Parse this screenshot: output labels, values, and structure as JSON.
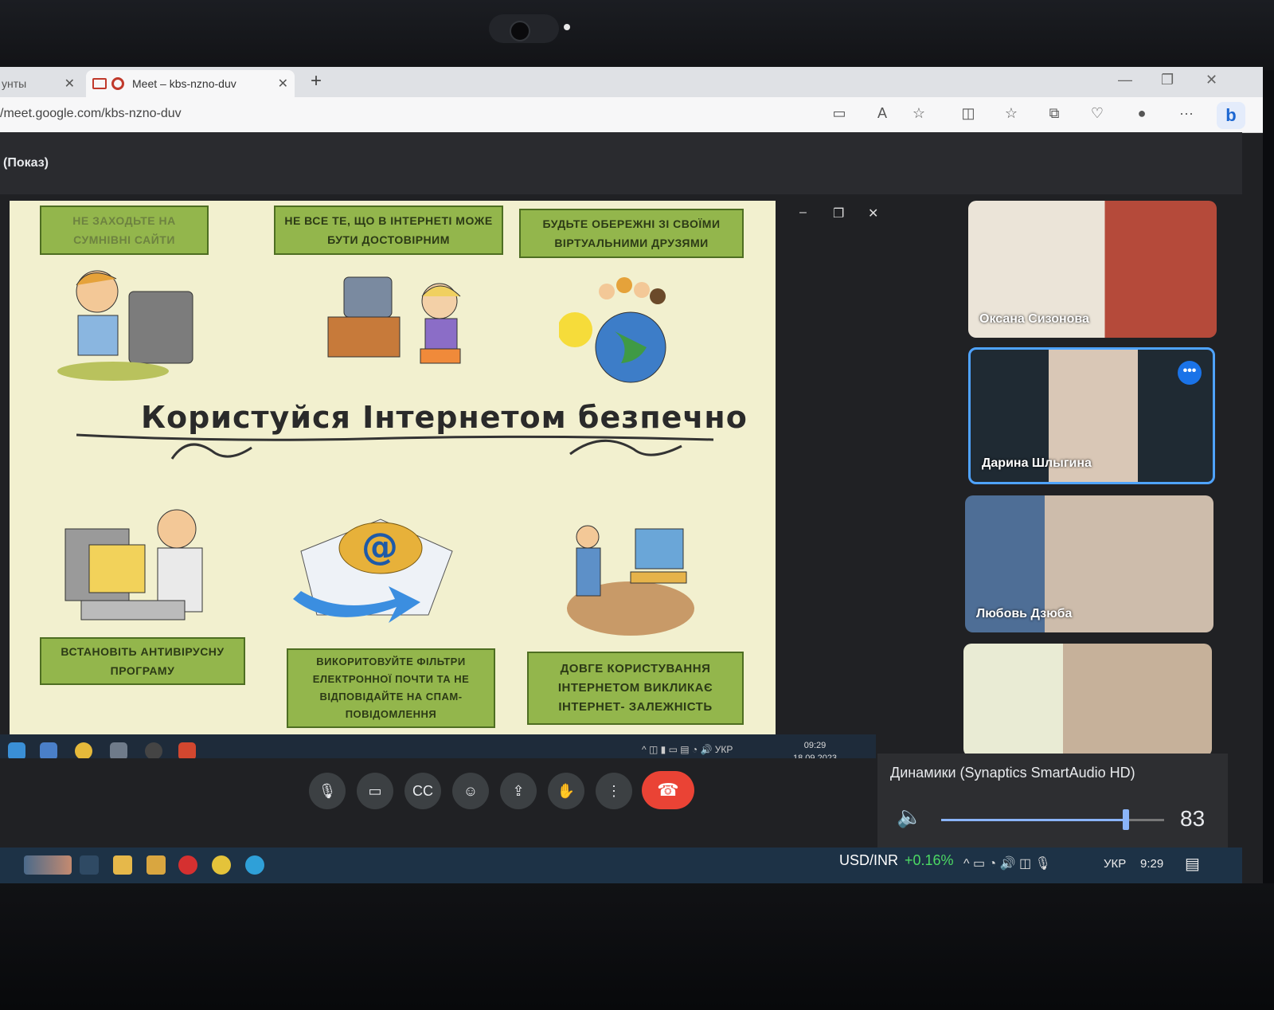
{
  "browser": {
    "inactive_tab_label": "унты",
    "active_tab_label": "Meet – kbs-nzno-duv",
    "url": "/meet.google.com/kbs-nzno-duv"
  },
  "meet": {
    "presentation_title": "(Показ)"
  },
  "slide": {
    "title": "Користуйся Інтернетом безпечно",
    "captions": [
      "НЕ ЗАХОДЬТЕ НА СУМНІВНІ САЙТИ",
      "НЕ ВСЕ ТЕ, ЩО В ІНТЕРНЕТІ МОЖЕ БУТИ ДОСТОВІРНИМ",
      "БУДЬТЕ ОБЕРЕЖНІ ЗІ СВОЇМИ ВІРТУАЛЬНИМИ ДРУЗЯМИ",
      "ВСТАНОВІТЬ АНТИВІРУСНУ ПРОГРАМУ",
      "ВИКОРИТОВУЙТЕ ФІЛЬТРИ ЕЛЕКТРОННОЇ ПОЧТИ ТА НЕ ВІДПОВІДАЙТЕ НА СПАМ-ПОВІДОМЛЕННЯ",
      "ДОВГЕ КОРИСТУВАННЯ ІНТЕРНЕТОМ ВИКЛИКАЄ ІНТЕРНЕТ- ЗАЛЕЖНІСТЬ"
    ]
  },
  "presenter_taskbar": {
    "lang": "УКР",
    "time": "09:29",
    "date": "18.09.2023"
  },
  "participants": [
    {
      "name": "Оксана Сизонова",
      "colors": [
        "#e9e2d6",
        "#b04a3a"
      ]
    },
    {
      "name": "Дарина Шлыгина",
      "colors": [
        "#1f2a33",
        "#d8c4b4"
      ],
      "active": true
    },
    {
      "name": "Любовь Дзюба",
      "colors": [
        "#5d7ea4",
        "#c9b8a8"
      ]
    },
    {
      "name": "",
      "colors": [
        "#e8ead4",
        "#c8b59e"
      ]
    }
  ],
  "audio": {
    "device_label": "Динамики (Synaptics SmartAudio HD)",
    "volume": 83
  },
  "taskbar": {
    "ticker_symbol": "USD/INR",
    "ticker_change": "+0.16%",
    "lang": "УКР",
    "time": "9:29"
  }
}
